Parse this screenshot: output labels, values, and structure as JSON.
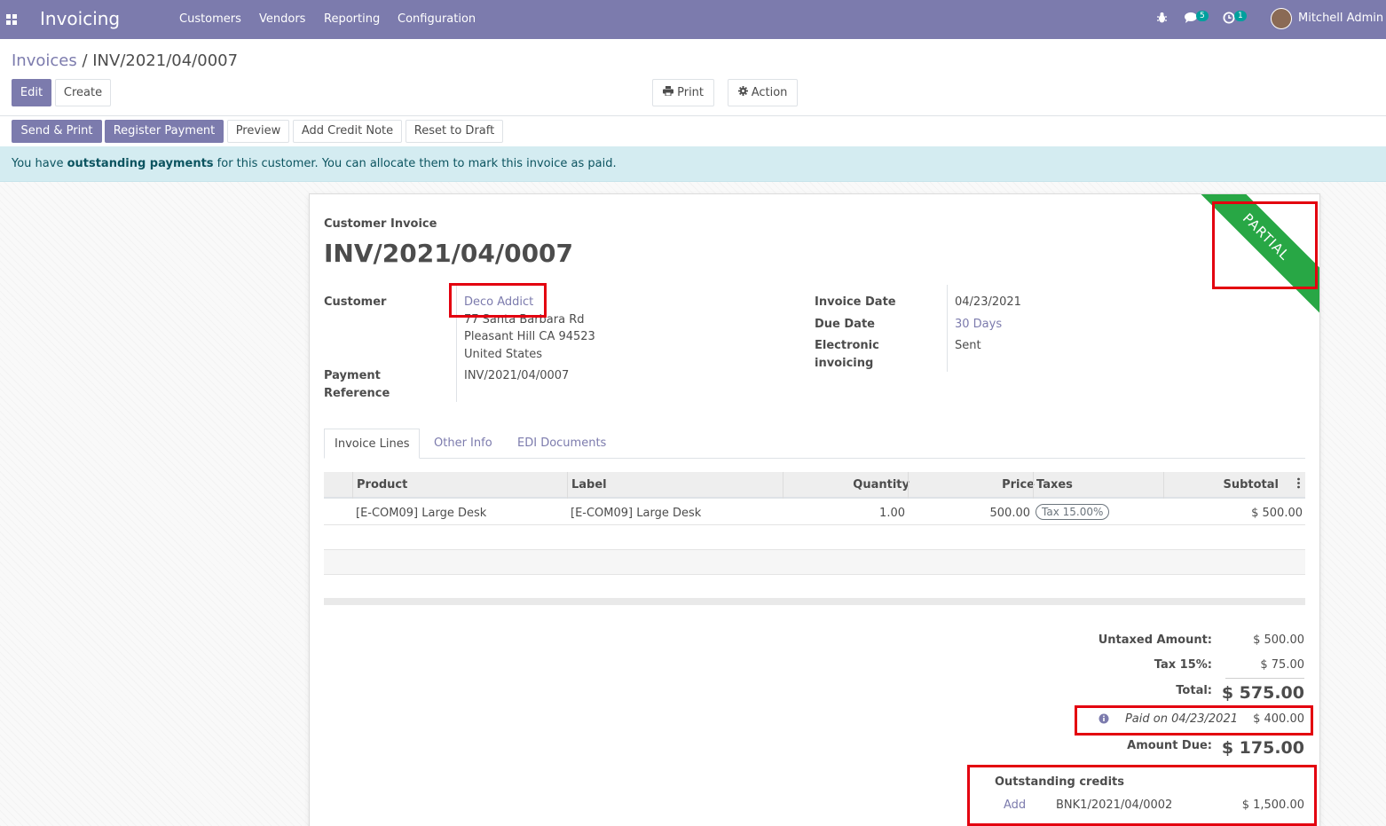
{
  "navbar": {
    "app_name": "Invoicing",
    "menu": [
      "Customers",
      "Vendors",
      "Reporting",
      "Configuration"
    ],
    "messages_count": "5",
    "activities_count": "1",
    "user_name": "Mitchell Admin",
    "bg_color": "#7c7bad"
  },
  "breadcrumb": {
    "parent": "Invoices",
    "separator": " / ",
    "current": "INV/2021/04/0007"
  },
  "actions": {
    "edit": "Edit",
    "create": "Create",
    "print": "Print",
    "action": "Action"
  },
  "statusbar": {
    "send_print": "Send & Print",
    "register_payment": "Register Payment",
    "preview": "Preview",
    "add_credit_note": "Add Credit Note",
    "reset_to_draft": "Reset to Draft"
  },
  "alert": {
    "prefix": "You have ",
    "bold": "outstanding payments",
    "suffix": " for this customer. You can allocate them to mark this invoice as paid."
  },
  "invoice": {
    "type_label": "Customer Invoice",
    "number": "INV/2021/04/0007",
    "ribbon": "PARTIAL",
    "customer_label": "Customer",
    "customer_name": "Deco Addict",
    "address_line1": "77 Santa Barbara Rd",
    "address_line2": "Pleasant Hill CA 94523",
    "address_line3": "United States",
    "payment_ref_label_1": "Payment",
    "payment_ref_label_2": "Reference",
    "payment_ref": "INV/2021/04/0007",
    "invoice_date_label": "Invoice Date",
    "invoice_date": "04/23/2021",
    "due_date_label": "Due Date",
    "due_date": "30 Days",
    "edi_label_1": "Electronic",
    "edi_label_2": "invoicing",
    "edi_value": "Sent"
  },
  "tabs": [
    "Invoice Lines",
    "Other Info",
    "EDI Documents"
  ],
  "lines": {
    "headers": {
      "product": "Product",
      "label": "Label",
      "quantity": "Quantity",
      "price": "Price",
      "taxes": "Taxes",
      "subtotal": "Subtotal"
    },
    "rows": [
      {
        "product": "[E-COM09] Large Desk",
        "label": "[E-COM09] Large Desk",
        "quantity": "1.00",
        "price": "500.00",
        "tax": "Tax 15.00%",
        "subtotal": "$ 500.00"
      }
    ]
  },
  "totals": {
    "untaxed_label": "Untaxed Amount:",
    "untaxed": "$ 500.00",
    "tax_label": "Tax 15%:",
    "tax": "$ 75.00",
    "total_label": "Total:",
    "total": "$ 575.00",
    "paid_label": "Paid on 04/23/2021",
    "paid": "$ 400.00",
    "due_label": "Amount Due:",
    "due": "$ 175.00"
  },
  "outstanding": {
    "title": "Outstanding credits",
    "add": "Add",
    "ref": "BNK1/2021/04/0002",
    "amount": "$ 1,500.00"
  }
}
